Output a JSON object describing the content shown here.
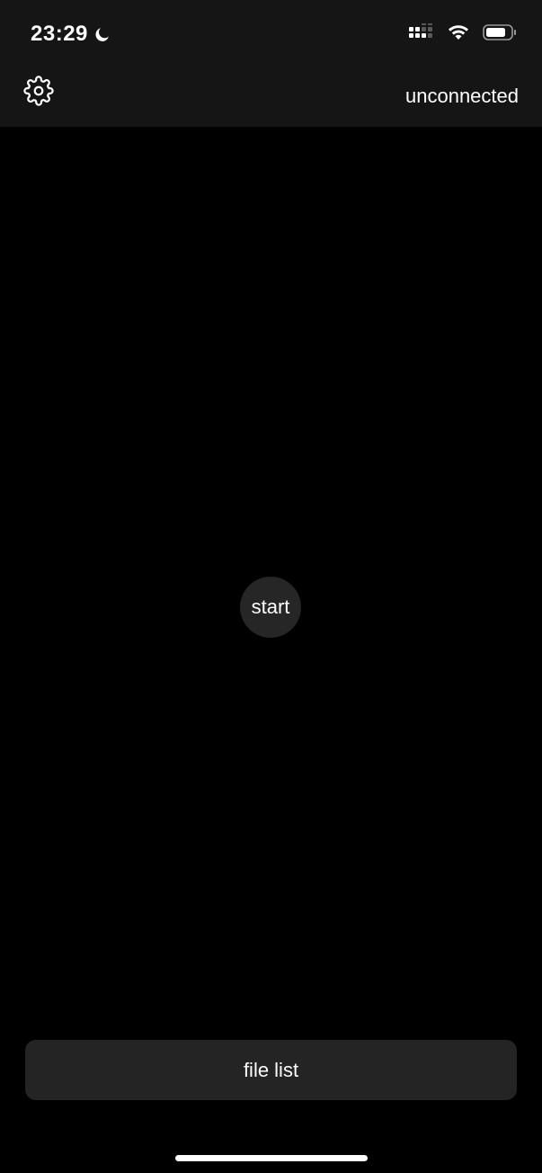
{
  "status_bar": {
    "time": "23:29",
    "icons": [
      "moon-icon",
      "signal-icon",
      "wifi-icon",
      "battery-icon"
    ]
  },
  "header": {
    "settings_icon": "gear-icon",
    "connection_status": "unconnected"
  },
  "main": {
    "start_label": "start"
  },
  "footer": {
    "file_list_label": "file list"
  },
  "colors": {
    "background": "#000000",
    "header_background": "#151515",
    "button_background": "#242424",
    "text": "#ffffff"
  }
}
